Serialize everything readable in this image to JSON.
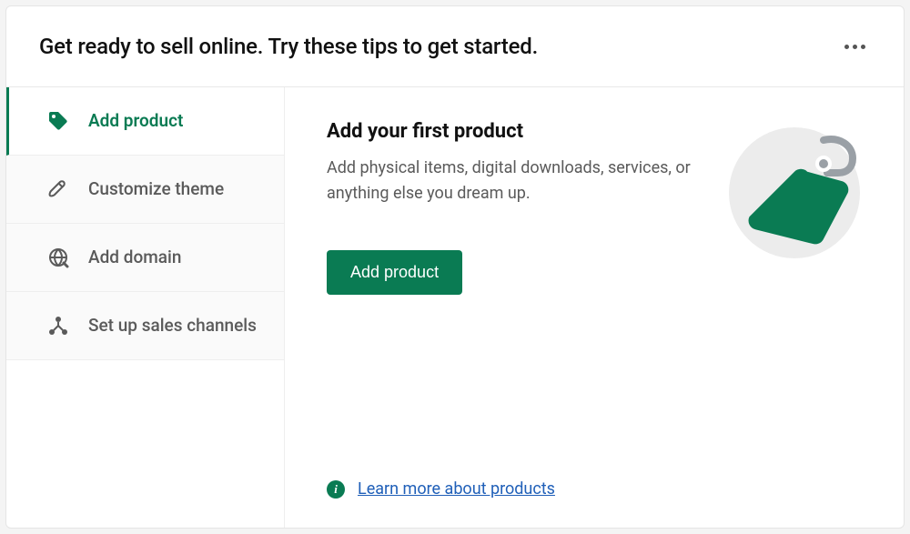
{
  "header": {
    "title": "Get ready to sell online. Try these tips to get started."
  },
  "sidebar": {
    "items": [
      {
        "label": "Add product",
        "icon": "tag-icon"
      },
      {
        "label": "Customize theme",
        "icon": "brush-icon"
      },
      {
        "label": "Add domain",
        "icon": "globe-icon"
      },
      {
        "label": "Set up sales channels",
        "icon": "share-icon"
      }
    ]
  },
  "content": {
    "title": "Add your first product",
    "description": "Add physical items, digital downloads, services, or anything else you dream up.",
    "cta_label": "Add product",
    "learn_more_label": "Learn more about products"
  },
  "colors": {
    "accent": "#0a7b53",
    "link": "#1f5fb8"
  }
}
